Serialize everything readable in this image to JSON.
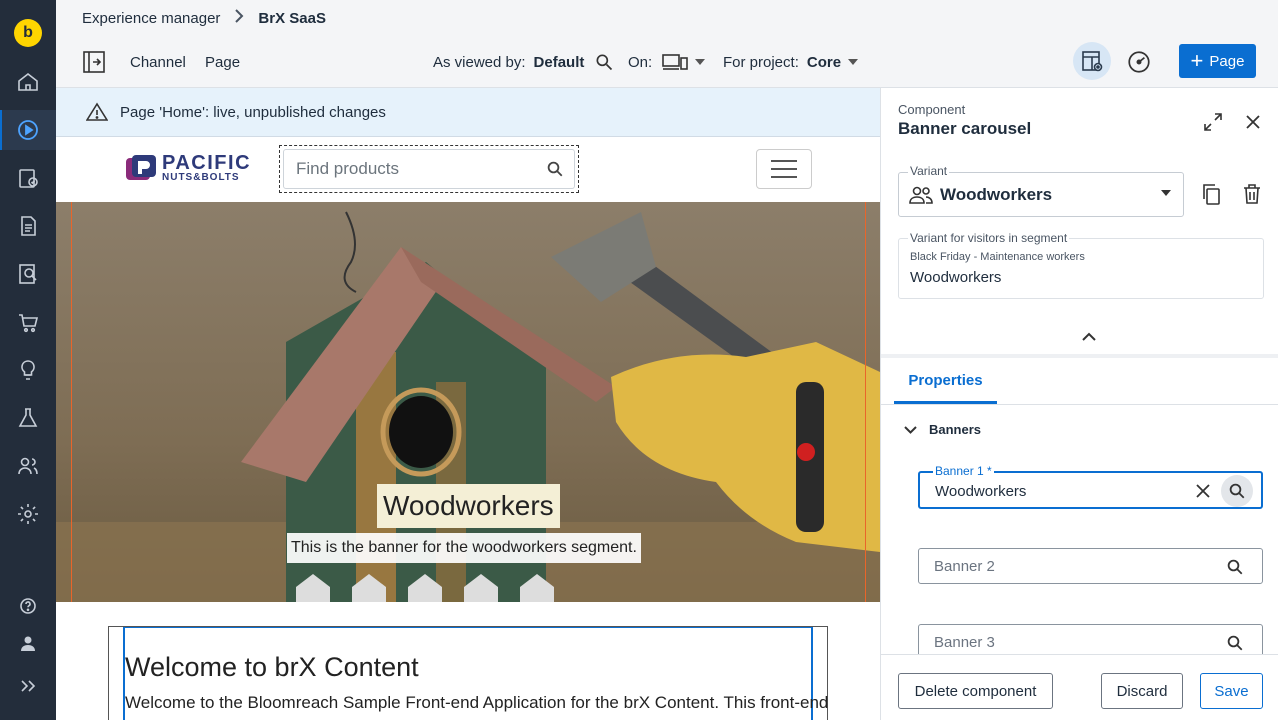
{
  "app": {
    "logo_letter": "b"
  },
  "rail": {
    "items": [
      "home",
      "experience-manager",
      "projects",
      "content",
      "seo",
      "commerce",
      "insights",
      "experiments",
      "audiences",
      "settings"
    ],
    "bottom": [
      "help",
      "user",
      "expand"
    ]
  },
  "breadcrumb": {
    "parent": "Experience manager",
    "current": "BrX SaaS"
  },
  "toolbar": {
    "channel": "Channel",
    "page": "Page",
    "viewed_by_label": "As viewed by:",
    "viewed_by_value": "Default",
    "on_label": "On:",
    "project_label": "For project:",
    "project_value": "Core",
    "add_page_label": "Page"
  },
  "alert": {
    "text": "Page 'Home': live, unpublished changes"
  },
  "site": {
    "brand_line1": "PACIFIC",
    "brand_line2": "NUTS&BOLTS",
    "search_placeholder": "Find products",
    "banner_title": "Woodworkers",
    "banner_subtitle": "This is the banner for the woodworkers segment.",
    "welcome_title": "Welcome to brX Content",
    "welcome_text": "Welcome to the Bloomreach Sample Front-end Application for the brX Content. This front-end"
  },
  "panel": {
    "component_label": "Component",
    "component_title": "Banner carousel",
    "variant_label": "Variant",
    "variant_value": "Woodworkers",
    "segment_label": "Variant for visitors in segment",
    "segment_name": "Black Friday - Maintenance workers",
    "segment_value": "Woodworkers",
    "tab_properties": "Properties",
    "section_banners": "Banners",
    "banner1_label": "Banner 1 *",
    "banner1_value": "Woodworkers",
    "banner2_placeholder": "Banner 2",
    "banner3_placeholder": "Banner 3",
    "delete_label": "Delete component",
    "discard_label": "Discard",
    "save_label": "Save"
  },
  "colors": {
    "accent": "#0a6ed1",
    "rail": "#232d3b",
    "selection": "#e9652a"
  }
}
